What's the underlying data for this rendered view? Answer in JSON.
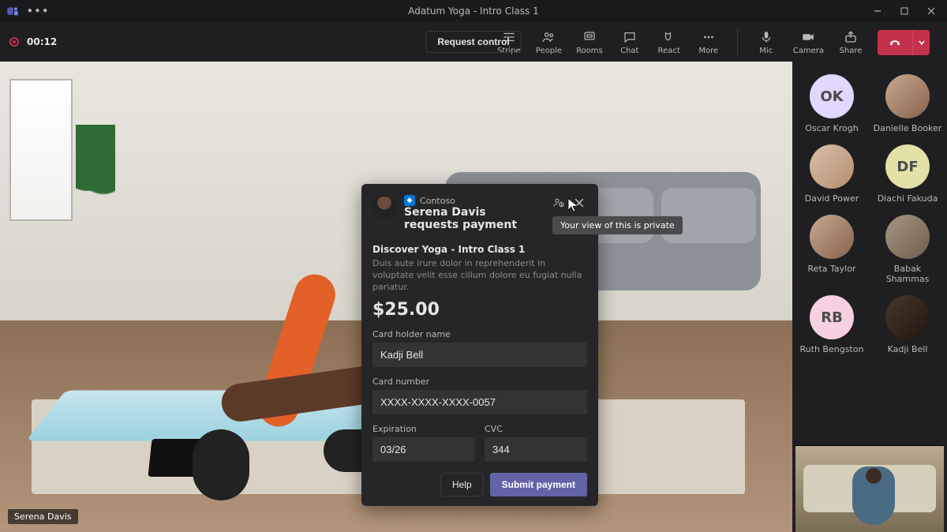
{
  "titleBar": {
    "appTitle": "Adatum Yoga - Intro Class 1"
  },
  "toolbar": {
    "recTime": "00:12",
    "requestControl": "Request control",
    "buttons": {
      "stripe": "Stripe",
      "people": "People",
      "rooms": "Rooms",
      "chat": "Chat",
      "react": "React",
      "more": "More",
      "mic": "Mic",
      "camera": "Camera",
      "share": "Share"
    }
  },
  "shared": {
    "speaker": "Serena Davis"
  },
  "card": {
    "brand": "Contoso",
    "title": "Serena Davis requests payment",
    "subject": "Discover Yoga - Intro Class 1",
    "description": "Duis aute irure dolor in reprehenderit in voluptate velit esse cillum dolore eu fugiat nulla pariatur.",
    "price": "$25.00",
    "labels": {
      "holder": "Card holder name",
      "number": "Card number",
      "exp": "Expiration",
      "cvc": "CVC"
    },
    "values": {
      "holder": "Kadji Bell",
      "number": "XXXX-XXXX-XXXX-0057",
      "exp": "03/26",
      "cvc": "344"
    },
    "help": "Help",
    "submit": "Submit payment",
    "tooltip": "Your view of this is private"
  },
  "participants": [
    {
      "initials": "OK",
      "style": "init init-purple",
      "name": "Oscar Krogh"
    },
    {
      "initials": "",
      "style": "photo",
      "name": "Danielle Booker"
    },
    {
      "initials": "",
      "style": "photo3",
      "name": "David Power"
    },
    {
      "initials": "DF",
      "style": "init init-olive",
      "name": "Diachi Fakuda"
    },
    {
      "initials": "",
      "style": "photo",
      "name": "Reta Taylor"
    },
    {
      "initials": "",
      "style": "photo4",
      "name": "Babak Shammas"
    },
    {
      "initials": "RB",
      "style": "init init-pink",
      "name": "Ruth Bengston"
    },
    {
      "initials": "",
      "style": "photo5",
      "name": "Kadji Bell"
    }
  ]
}
